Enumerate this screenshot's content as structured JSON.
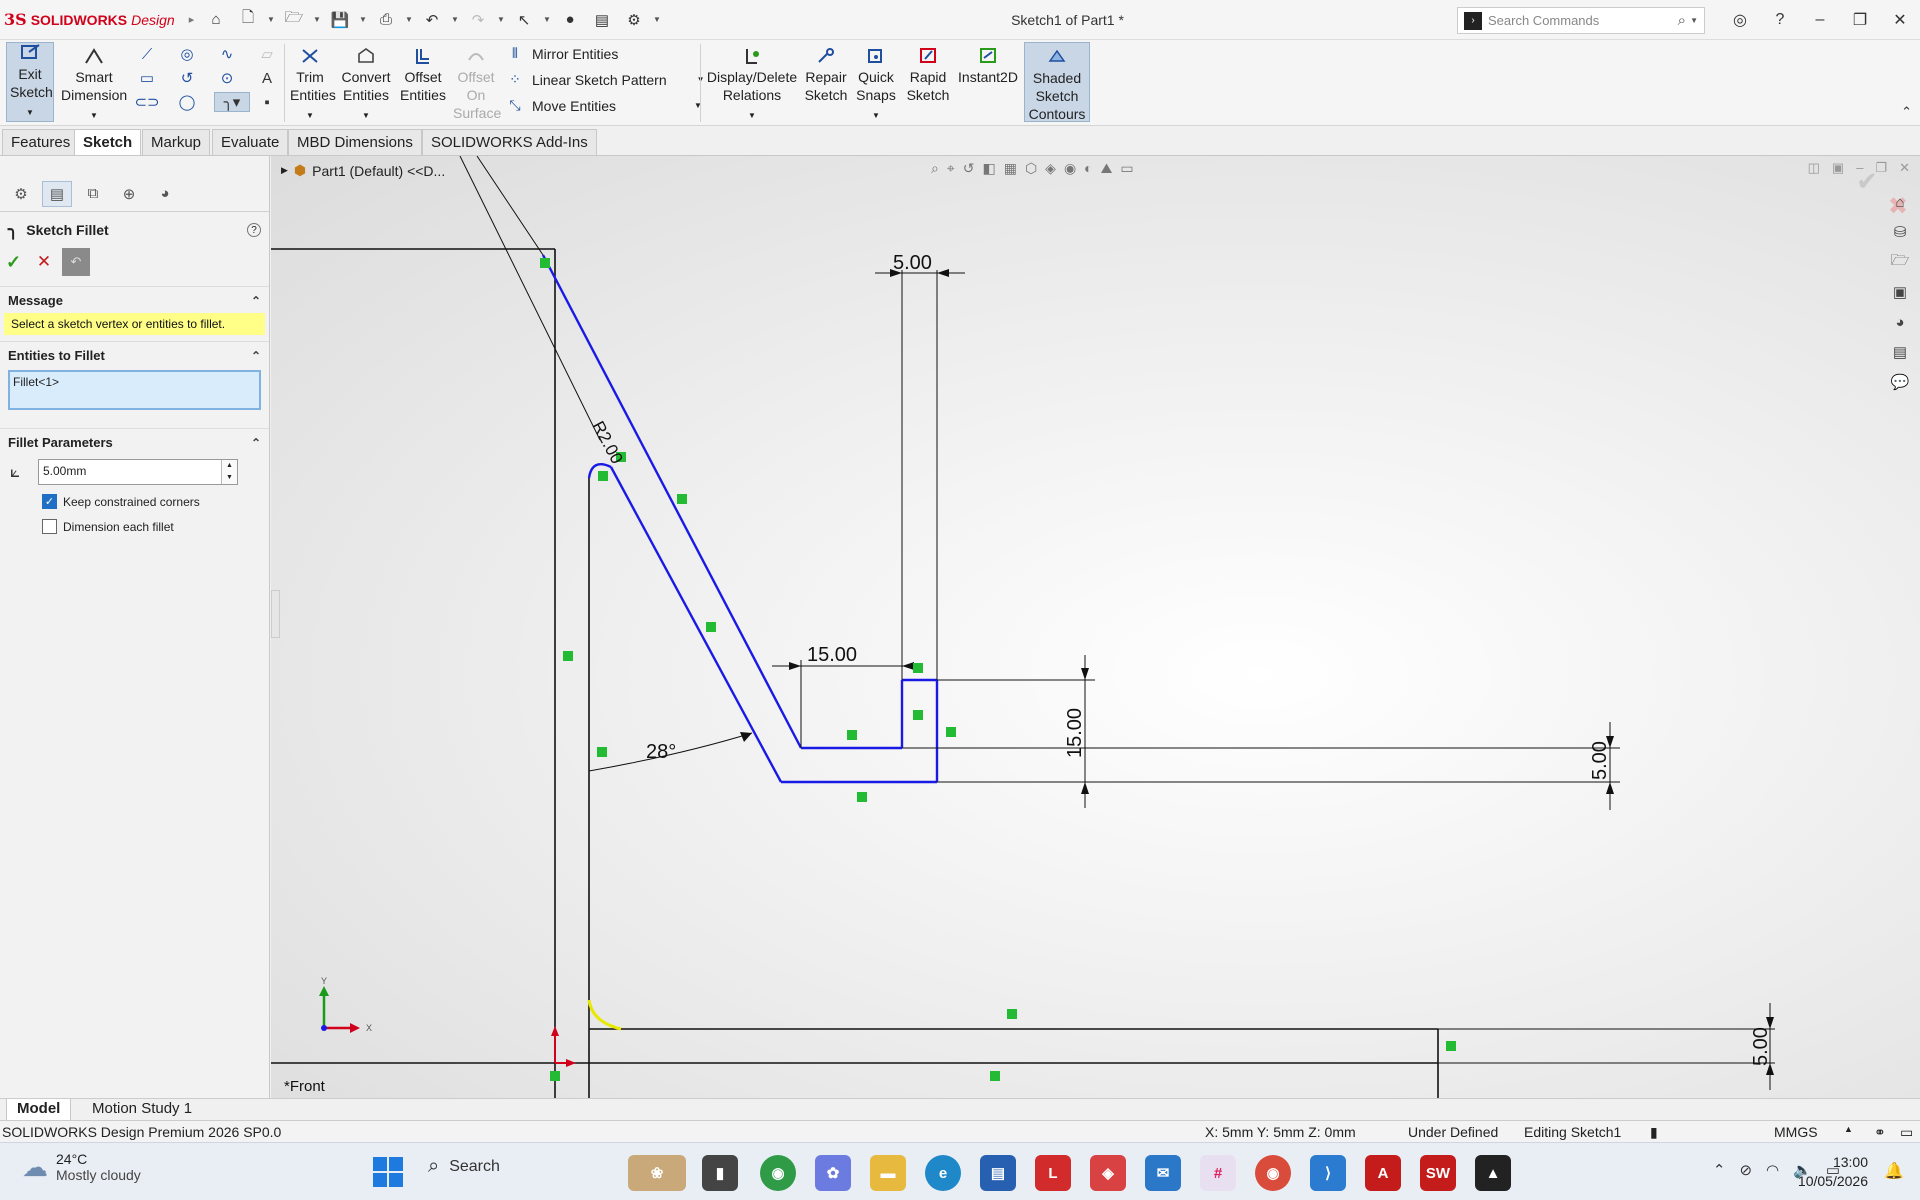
{
  "titlebar": {
    "brand_ds": "3S",
    "brand_name": "SOLIDWORKS",
    "brand_suffix": "Design",
    "document_title": "Sketch1 of Part1 *",
    "search_placeholder": "Search Commands"
  },
  "ribbon": {
    "exit_sketch": "Exit Sketch",
    "smart_dimension": "Smart Dimension",
    "trim_entities": "Trim Entities",
    "convert_entities": "Convert Entities",
    "offset_entities": "Offset Entities",
    "offset_on_surface": "Offset On Surface",
    "mirror_entities": "Mirror Entities",
    "linear_sketch_pattern": "Linear Sketch Pattern",
    "move_entities": "Move Entities",
    "display_delete_relations": "Display/Delete Relations",
    "repair_sketch": "Repair Sketch",
    "quick_snaps": "Quick Snaps",
    "rapid_sketch": "Rapid Sketch",
    "instant2d": "Instant2D",
    "shaded_sketch_contours": "Shaded Sketch Contours"
  },
  "cm_tabs": [
    "Features",
    "Sketch",
    "Markup",
    "Evaluate",
    "MBD Dimensions",
    "SOLIDWORKS Add-Ins"
  ],
  "feature_tree": {
    "crumb": "Part1 (Default) <<D..."
  },
  "property_manager": {
    "title": "Sketch Fillet",
    "message_header": "Message",
    "message_text": "Select a sketch vertex or entities to fillet.",
    "entities_header": "Entities to Fillet",
    "entities_value": "Fillet<1>",
    "params_header": "Fillet Parameters",
    "radius_value": "5.00mm",
    "keep_corners_label": "Keep constrained corners",
    "keep_corners_checked": true,
    "dimension_each_label": "Dimension each fillet",
    "dimension_each_checked": false
  },
  "sketch": {
    "dims": {
      "top_width": "5.00",
      "slot_width": "15.00",
      "slot_height": "15.00",
      "right_thickness": "5.00",
      "bottom_thickness": "5.00",
      "angle": "28°",
      "fillet_radius": "R2.00"
    },
    "view_name": "*Front",
    "triad_y": "Y",
    "triad_x": "X"
  },
  "bottom_tabs": [
    "Model",
    "Motion Study 1"
  ],
  "status": {
    "product": "SOLIDWORKS Design Premium 2026 SP0.0",
    "coords": "X: 5mm Y: 5mm Z: 0mm",
    "state": "Under Defined",
    "editing": "Editing Sketch1",
    "units": "MMGS"
  },
  "taskbar": {
    "temperature": "24°C",
    "weather": "Mostly cloudy",
    "search_label": "Search",
    "time": "13:00",
    "date": "10/05/2026"
  },
  "colors": {
    "sketch_line": "#1a1ae6",
    "constraint_marker": "#22bb33",
    "fillet_preview": "#e8e800",
    "message_bg": "#ffff88",
    "brand_red": "#d0021b"
  }
}
